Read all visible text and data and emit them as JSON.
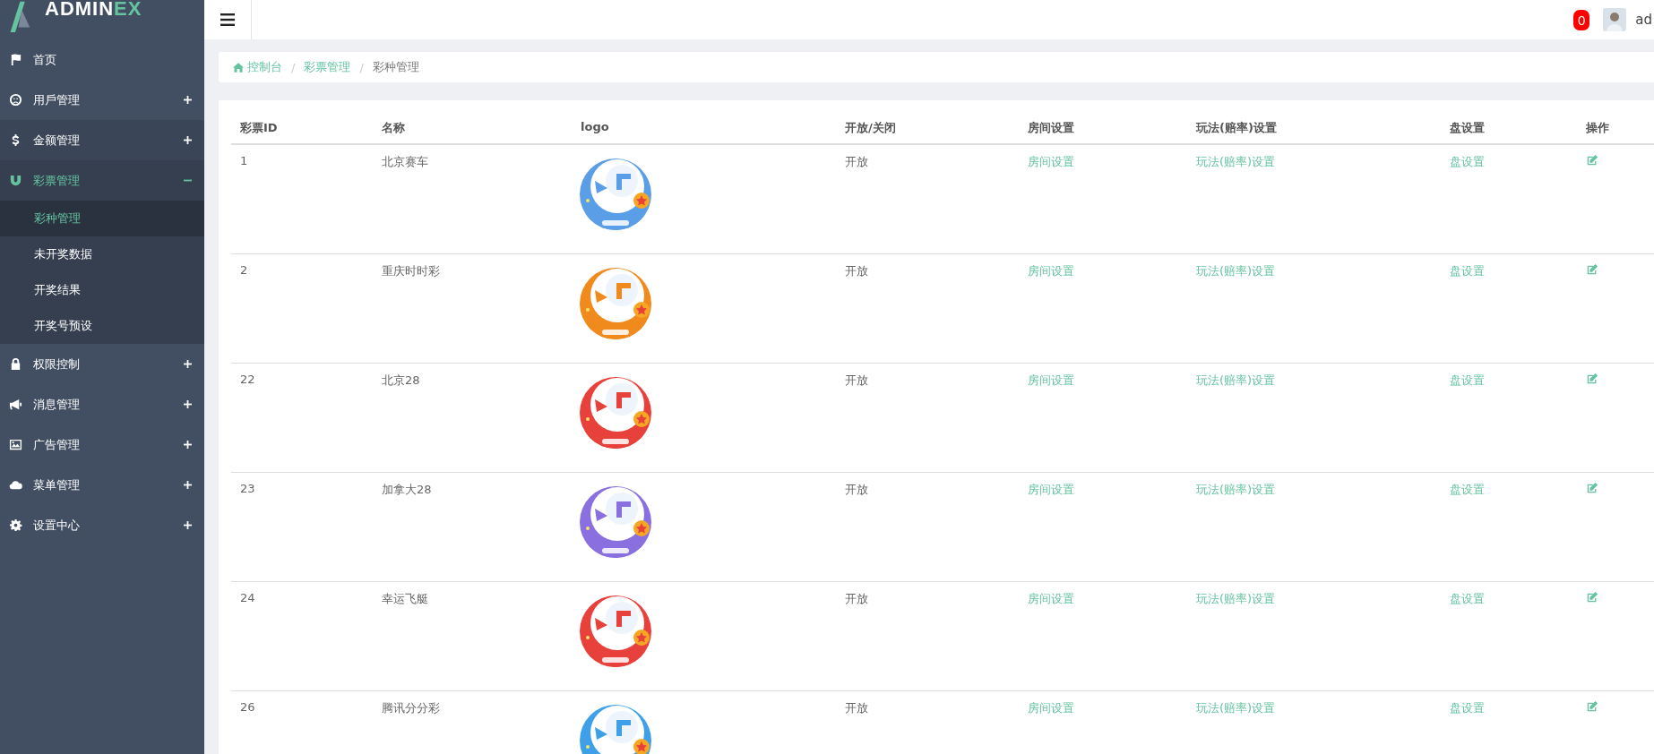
{
  "brand": {
    "main": "ADMIN",
    "accent": "EX"
  },
  "header": {
    "notification_count": "0",
    "user_name": "ad"
  },
  "sidebar": {
    "items": [
      {
        "label": "首页",
        "expandable": false,
        "selected": false
      },
      {
        "label": "用戶管理",
        "expandable": true,
        "expanded": false,
        "selected": false
      },
      {
        "label": "金额管理",
        "expandable": true,
        "expanded": false,
        "selected": false
      },
      {
        "label": "彩票管理",
        "expandable": true,
        "expanded": true,
        "selected": true,
        "children": [
          {
            "label": "彩种管理",
            "selected": true
          },
          {
            "label": "未开奖数据",
            "selected": false
          },
          {
            "label": "开奖结果",
            "selected": false
          },
          {
            "label": "开奖号预设",
            "selected": false
          }
        ]
      },
      {
        "label": "权限控制",
        "expandable": true,
        "expanded": false,
        "selected": false
      },
      {
        "label": "消息管理",
        "expandable": true,
        "expanded": false,
        "selected": false
      },
      {
        "label": "广告管理",
        "expandable": true,
        "expanded": false,
        "selected": false
      },
      {
        "label": "菜单管理",
        "expandable": true,
        "expanded": false,
        "selected": false
      },
      {
        "label": "设置中心",
        "expandable": true,
        "expanded": false,
        "selected": false
      }
    ]
  },
  "breadcrumb": [
    {
      "label": "控制台",
      "link": true
    },
    {
      "separator": "/",
      "label": "彩票管理",
      "link": true
    },
    {
      "separator": "/",
      "label": "彩种管理",
      "link": false
    }
  ],
  "table": {
    "columns": [
      "彩票ID",
      "名称",
      "logo",
      "开放/关闭",
      "房间设置",
      "玩法(赔率)设置",
      "盘设置",
      "操作"
    ],
    "rows": [
      {
        "id": "1",
        "name": "北京赛车",
        "status": "开放",
        "room": "房间设置",
        "play": "玩法(赔率)设置",
        "pan": "盘设置"
      },
      {
        "id": "2",
        "name": "重庆时时彩",
        "status": "开放",
        "room": "房间设置",
        "play": "玩法(赔率)设置",
        "pan": "盘设置"
      },
      {
        "id": "22",
        "name": "北京28",
        "status": "开放",
        "room": "房间设置",
        "play": "玩法(赔率)设置",
        "pan": "盘设置"
      },
      {
        "id": "23",
        "name": "加拿大28",
        "status": "开放",
        "room": "房间设置",
        "play": "玩法(赔率)设置",
        "pan": "盘设置"
      },
      {
        "id": "24",
        "name": "幸运飞艇",
        "status": "开放",
        "room": "房间设置",
        "play": "玩法(赔率)设置",
        "pan": "盘设置"
      },
      {
        "id": "26",
        "name": "腾讯分分彩",
        "status": "开放",
        "room": "房间设置",
        "play": "玩法(赔率)设置",
        "pan": "盘设置"
      }
    ]
  }
}
